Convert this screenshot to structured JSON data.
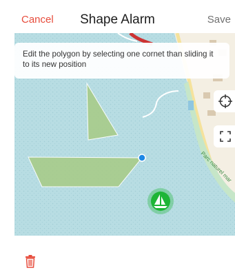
{
  "header": {
    "cancel_label": "Cancel",
    "title": "Shape Alarm",
    "save_label": "Save"
  },
  "map": {
    "hint_text": "Edit the polygon by selecting one cornet than sliding it to its new position",
    "park_label": "Parc naturel mar",
    "polygon_color": "#a8cc8c",
    "selected_corner_color": "#1e88e5",
    "boat_color": "#1db536",
    "water_color": "#b8dde3",
    "land_color": "#f4efe3"
  },
  "controls": {
    "locate_icon": "crosshair-icon",
    "fullscreen_icon": "fullscreen-icon",
    "delete_icon": "trash-icon"
  },
  "colors": {
    "cancel": "#e74c3c",
    "save": "#707070",
    "trash": "#e74c3c"
  }
}
